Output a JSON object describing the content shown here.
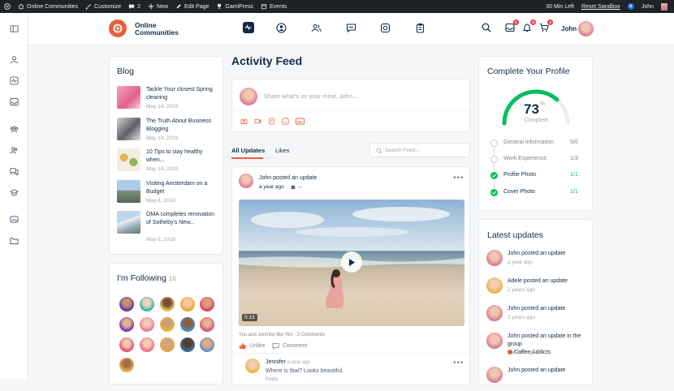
{
  "adminbar": {
    "site": "Online Communities",
    "customize": "Customize",
    "comments": "2",
    "new": "New",
    "edit": "Edit Page",
    "gamipress": "GamiPress",
    "events": "Events",
    "time_left": "30 Min Left",
    "sandbox": "Reset Sandbox",
    "user": "John"
  },
  "header": {
    "logo_text": "Online Communities",
    "user_name": "John",
    "badges": {
      "messages": "1",
      "notifications": "8",
      "cart": "3"
    }
  },
  "blog": {
    "title": "Blog",
    "items": [
      {
        "title": "Tackle Your closest Spring cleaning",
        "date": "May 14, 2019"
      },
      {
        "title": "The Truth About Business Blogging",
        "date": "May 14, 2019"
      },
      {
        "title": "10 Tips to stay healthy when...",
        "date": "May 14, 2019"
      },
      {
        "title": "Visiting Amsterdam on a Budget",
        "date": "May 8, 2019"
      },
      {
        "title": "OMA completes renovation of Sotheby's New...",
        "date": "May 8, 2019"
      }
    ]
  },
  "following": {
    "title": "I'm Following",
    "count": "16"
  },
  "feed": {
    "title": "Activity Feed",
    "composer_placeholder": "Share what's on your mind, John...",
    "tabs": [
      "All Updates",
      "Likes"
    ],
    "search_placeholder": "Search Feed...",
    "post": {
      "author": "John",
      "action": "posted an update",
      "time": "a year ago",
      "video_duration": "0:13",
      "likes_text": "You and Jennifer like this",
      "comments_count": "2 Comments",
      "unlike": "Unlike",
      "comment": "Comment"
    },
    "comment": {
      "author": "Jennifer",
      "time": "a year ago",
      "text": "Where is that? Looks beautiful.",
      "reply": "Reply"
    }
  },
  "profile": {
    "title": "Complete Your Profile",
    "percent": "73",
    "percent_sign": "%",
    "complete_label": "Complete",
    "progress": 0.73,
    "steps": [
      {
        "label": "General Information",
        "count": "5/6",
        "done": false
      },
      {
        "label": "Work Experience",
        "count": "1/3",
        "done": false
      },
      {
        "label": "Profile Photo",
        "count": "1/1",
        "done": true
      },
      {
        "label": "Cover Photo",
        "count": "1/1",
        "done": true
      }
    ]
  },
  "latest": {
    "title": "Latest updates",
    "items": [
      {
        "text": "John posted an update",
        "time": "a year ago"
      },
      {
        "text": "Adele posted an update",
        "time": "2 years ago"
      },
      {
        "text": "John posted an update",
        "time": "2 years ago"
      },
      {
        "text": "John posted an update in the group",
        "group": "Coffee Addicts",
        "time": "2 years ago"
      },
      {
        "text": "John posted an update",
        "time": ""
      }
    ]
  },
  "colors": {
    "accent": "#00c05a",
    "brand": "#e8603c",
    "action_orange": "#e8603c",
    "badge": "#ef3e46"
  }
}
